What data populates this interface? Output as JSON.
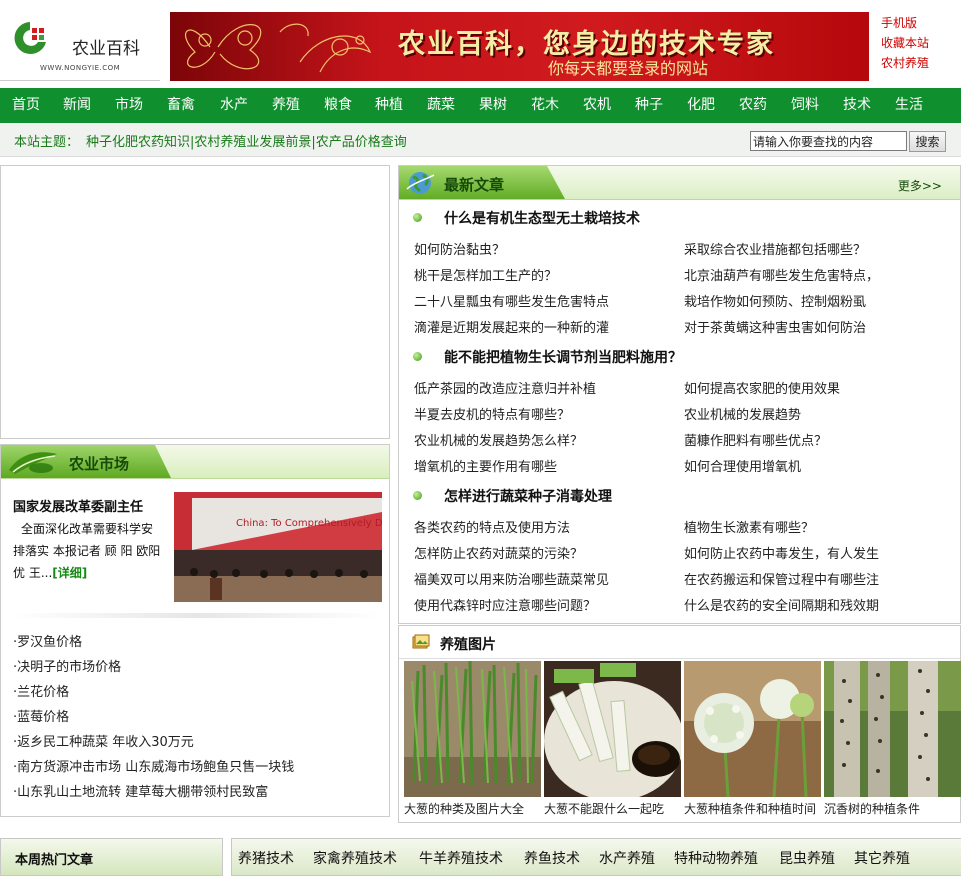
{
  "header": {
    "logo_title": "农业百科",
    "logo_url": "WWW.NONGYIE.COM",
    "banner_main": "农业百科，您身边的技术专家",
    "banner_sub": "你每天都要登录的网站",
    "top_links": [
      "手机版",
      "收藏本站",
      "农村养殖"
    ]
  },
  "nav": [
    "首页",
    "新闻",
    "市场",
    "畜禽",
    "水产",
    "养殖",
    "粮食",
    "种植",
    "蔬菜",
    "果树",
    "花木",
    "农机",
    "种子",
    "化肥",
    "农药",
    "饲料",
    "技术",
    "生活"
  ],
  "topic_bar": {
    "label": "本站主题：",
    "links": "种子化肥农药知识|农村养殖业发展前景|农产品价格查询",
    "search_placeholder": "请输入你要查找的内容",
    "search_button": "搜索"
  },
  "market": {
    "title": "农业市场",
    "feature_title": "国家发展改革委副主任",
    "feature_body": "全面深化改革需要科学安排落实 本报记者 顾 阳 欧阳优 王...",
    "feature_detail": "[详细]",
    "feature_image_text": "China: To Comprehensively Deep",
    "list": [
      "·罗汉鱼价格",
      "·决明子的市场价格",
      "·兰花价格",
      "·蓝莓价格",
      "·返乡民工种蔬菜 年收入30万元",
      "·南方货源冲击市场 山东威海市场鲍鱼只售一块钱",
      "·山东乳山土地流转 建草莓大棚带领村民致富"
    ]
  },
  "latest": {
    "title": "最新文章",
    "more": "更多>>",
    "groups": [
      {
        "title": "什么是有机生态型无土栽培技术",
        "links": [
          "如何防治黏虫？",
          "采取综合农业措施都包括哪些？",
          "桃干是怎样加工生产的？",
          "北京油葫芦有哪些发生危害特点，",
          "二十八星瓢虫有哪些发生危害特点",
          "栽培作物如何预防、控制烟粉虱",
          "滴灌是近期发展起来的一种新的灌",
          "对于茶黄螨这种害虫害如何防治"
        ]
      },
      {
        "title": "能不能把植物生长调节剂当肥料施用？",
        "links": [
          "低产茶园的改造应注意归并补植",
          "如何提高农家肥的使用效果",
          "半夏去皮机的特点有哪些？",
          "农业机械的发展趋势",
          "农业机械的发展趋势怎么样？",
          "菌糠作肥料有哪些优点？",
          "增氧机的主要作用有哪些",
          "如何合理使用增氧机"
        ]
      },
      {
        "title": "怎样进行蔬菜种子消毒处理",
        "links": [
          "各类农药的特点及使用方法",
          "植物生长激素有哪些？",
          "怎样防止农药对蔬菜的污染？",
          "如何防止农药中毒发生，有人发生",
          "福美双可以用来防治哪些蔬菜常见",
          "在农药搬运和保管过程中有哪些注",
          "使用代森锌时应注意哪些问题？",
          "什么是农药的安全间隔期和残效期"
        ]
      }
    ]
  },
  "pictures": {
    "title": "养殖图片",
    "items": [
      "大葱的种类及图片大全",
      "大葱不能跟什么一起吃",
      "大葱种植条件和种植时间",
      "沉香树的种植条件"
    ]
  },
  "bottom": {
    "hot_title": "本周热门文章",
    "tabs": [
      "养猪技术",
      "家禽养殖技术",
      "牛羊养殖技术",
      "养鱼技术",
      "水产养殖",
      "特种动物养殖",
      "昆虫养殖",
      "其它养殖"
    ]
  },
  "colors": {
    "nav_green": "#0f8f2e",
    "banner_red": "#c5141a",
    "link_red": "#cc0000"
  }
}
